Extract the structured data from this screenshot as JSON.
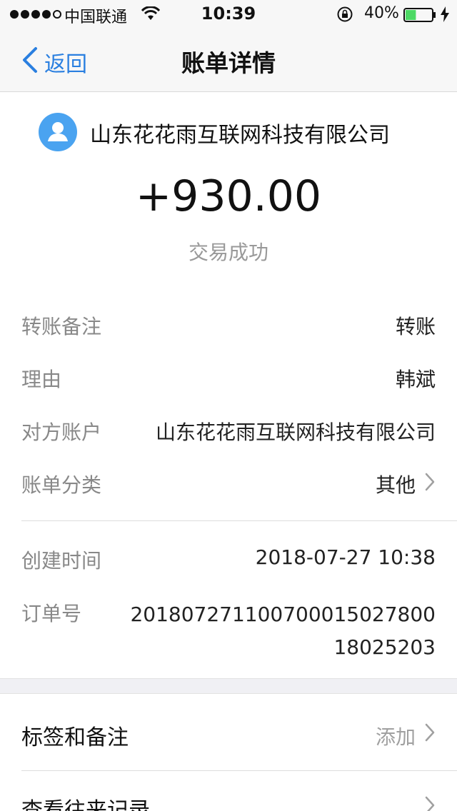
{
  "status_bar": {
    "carrier": "中国联通",
    "time": "10:39",
    "battery": "40%",
    "battery_level": 0.4
  },
  "nav": {
    "back_label": "返回",
    "title": "账单详情"
  },
  "header": {
    "merchant": "山东花花雨互联网科技有限公司",
    "amount": "+930.00",
    "status": "交易成功"
  },
  "details": [
    {
      "label": "转账备注",
      "value": "转账"
    },
    {
      "label": "理由",
      "value": "韩斌"
    },
    {
      "label": "对方账户",
      "value": "山东花花雨互联网科技有限公司"
    },
    {
      "label": "账单分类",
      "value": "其他"
    }
  ],
  "meta": {
    "created_label": "创建时间",
    "created_value": "2018-07-27 10:38",
    "order_label": "订单号",
    "order_value": "20180727110070001502780018025203"
  },
  "actions": {
    "tags_label": "标签和备注",
    "tags_hint": "添加",
    "history_label": "查看往来记录"
  },
  "colors": {
    "accent": "#2a7fe0",
    "avatar": "#4aa3f0",
    "battery": "#4cd964"
  }
}
